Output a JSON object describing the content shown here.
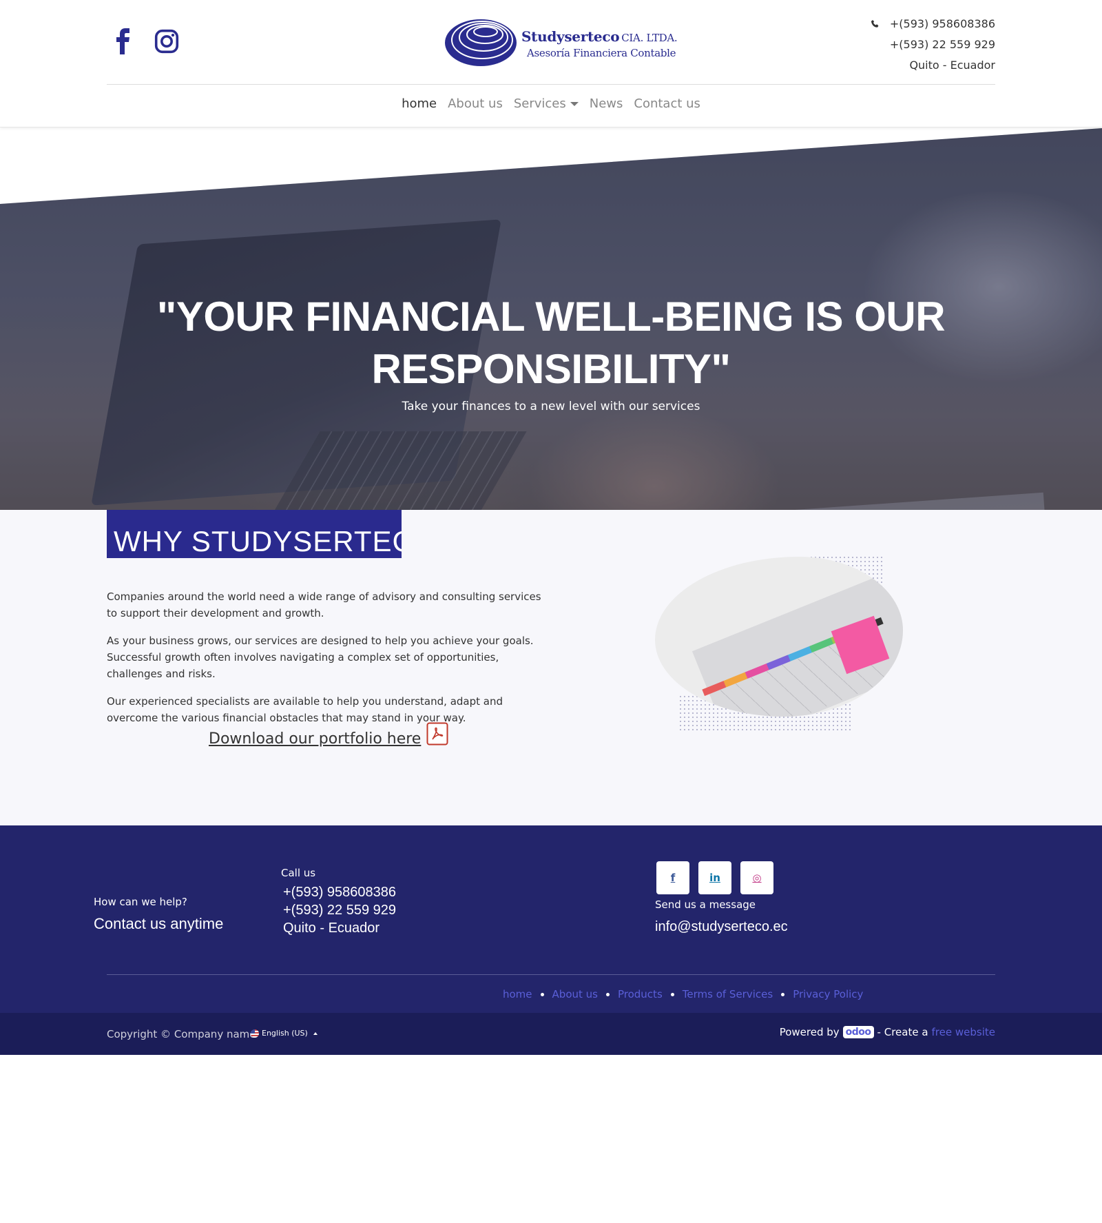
{
  "header": {
    "logo": {
      "name": "Studyserteco",
      "suffix": "CIA. LTDA.",
      "tagline": "Asesoría Financiera Contable"
    },
    "social_icons": [
      "facebook-icon",
      "instagram-icon"
    ],
    "contact": {
      "phone1": "+(593) 958608386",
      "phone2": "+(593) 22 559 929",
      "location": "Quito - Ecuador"
    },
    "nav": [
      {
        "label": "home",
        "active": true
      },
      {
        "label": "About us"
      },
      {
        "label": "Services",
        "dropdown": true
      },
      {
        "label": "News"
      },
      {
        "label": "Contact us"
      }
    ]
  },
  "hero": {
    "title": "\"YOUR FINANCIAL WELL-BEING IS OUR RESPONSIBILITY\"",
    "subtitle": "Take your finances to a new level with our services"
  },
  "why": {
    "heading": "WHY STUDYSERTECO?",
    "paragraphs": [
      "Companies around the world need a wide range of advisory and consulting services to support their development and growth.",
      "As your business grows, our services are designed to help you achieve your goals. Successful growth often involves navigating a complex set of opportunities, challenges and risks.",
      "Our experienced specialists are available to help you understand, adapt and overcome the various financial obstacles that may stand in your way."
    ],
    "download_label": "Download our portfolio here"
  },
  "footer": {
    "help_label": "How can we help?",
    "help_big": "Contact us anytime",
    "call_label": "Call us",
    "call_lines": [
      "+(593) 958608386",
      "+(593) 22 559 929",
      "Quito - Ecuador"
    ],
    "social_buttons": [
      {
        "icon": "facebook-icon",
        "glyph": "f"
      },
      {
        "icon": "linkedin-icon",
        "glyph": "in"
      },
      {
        "icon": "instagram-icon",
        "glyph": "◎"
      }
    ],
    "message_label": "Send us a message",
    "email": "info@studyserteco.ec",
    "links": [
      "home",
      "About us",
      "Products",
      "Terms of Services",
      "Privacy Policy"
    ]
  },
  "bottom": {
    "copyright": "Copyright © Company name",
    "language": "English (US)",
    "powered_by": "Powered by",
    "odoo": "odoo",
    "create": "- Create a",
    "free_website": "free website"
  },
  "colors": {
    "brand_blue": "#2a2c8f",
    "footer_bg": "#23256b",
    "bottom_bg": "#1b1d58",
    "link_blue": "#5a5fd8",
    "section_bg": "#f7f7fb"
  }
}
